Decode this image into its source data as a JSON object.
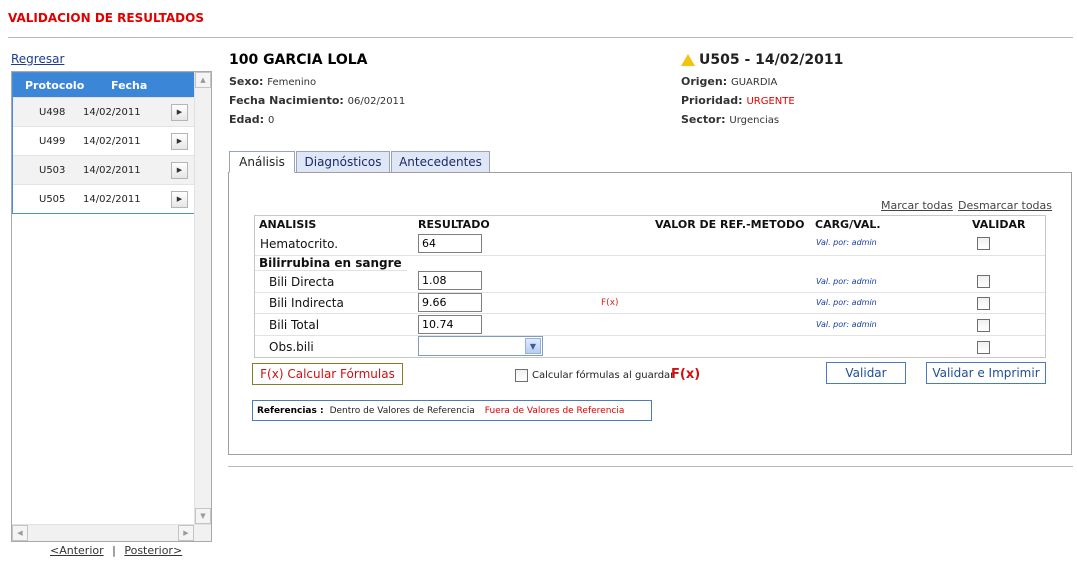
{
  "page": {
    "title": "VALIDACION DE RESULTADOS"
  },
  "nav": {
    "back": "Regresar",
    "prev": "<Anterior",
    "separator": "|",
    "next": "Posterior>"
  },
  "protocols": {
    "headers": [
      "Protocolo",
      "Fecha"
    ],
    "rows": [
      {
        "id": "U498",
        "date": "14/02/2011"
      },
      {
        "id": "U499",
        "date": "14/02/2011"
      },
      {
        "id": "U503",
        "date": "14/02/2011"
      },
      {
        "id": "U505",
        "date": "14/02/2011"
      }
    ]
  },
  "patient": {
    "name": "100  GARCIA LOLA",
    "sexo_label": "Sexo:",
    "sexo": "Femenino",
    "nac_label": "Fecha Nacimiento:",
    "nac": "06/02/2011",
    "edad_label": "Edad:",
    "edad": "0"
  },
  "protocol": {
    "title": "U505 - 14/02/2011",
    "origen_label": "Origen:",
    "origen": "GUARDIA",
    "prioridad_label": "Prioridad:",
    "prioridad": "URGENTE",
    "sector_label": "Sector:",
    "sector": "Urgencias"
  },
  "tabs": [
    "Análisis",
    "Diagnósticos",
    "Antecedentes"
  ],
  "links": {
    "mark_all": "Marcar todas",
    "unmark_all": "Desmarcar todas"
  },
  "grid": {
    "headers": [
      "ANALISIS",
      "RESULTADO",
      "VALOR DE REF.-METODO",
      "CARG/VAL.",
      "VALIDAR"
    ],
    "rows": [
      {
        "label": "Hematocrito.",
        "value": "64",
        "fx": "",
        "val": "Val. por: admin"
      },
      {
        "group": "Bilirrubina en sangre"
      },
      {
        "label": "Bili Directa",
        "value": "1.08",
        "fx": "",
        "val": "Val. por: admin"
      },
      {
        "label": "Bili Indirecta",
        "value": "9.66",
        "fx": "F(x)",
        "val": "Val. por: admin"
      },
      {
        "label": "Bili Total",
        "value": "10.74",
        "fx": "",
        "val": "Val. por: admin"
      },
      {
        "label": "Obs.bili",
        "value": "",
        "fx": "",
        "val": ""
      }
    ]
  },
  "actions": {
    "calc_button": "F(x) Calcular Fórmulas",
    "calc_checkbox": "Calcular fórmulas al guardar",
    "fx": "F(x)",
    "validate": "Validar",
    "validate_print": "Validar e Imprimir"
  },
  "references": {
    "label": "Referencias :",
    "inside": "Dentro de Valores de Referencia",
    "outside": "Fuera de Valores de Referencia"
  },
  "colors": {
    "accent_red": "#e00000",
    "header_blue": "#3c86d8",
    "tab_blue": "#dfe6f6"
  }
}
